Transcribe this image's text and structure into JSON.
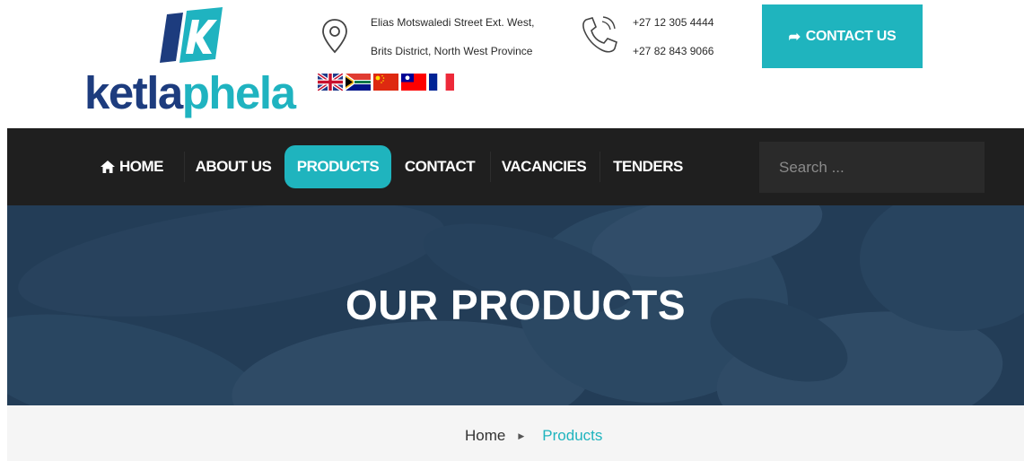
{
  "brand": {
    "name_part1": "ketla",
    "name_part2": "phela",
    "logo_letter": "K",
    "color_dark": "#1d3c7e",
    "color_accent": "#1fb3c0"
  },
  "header": {
    "address_icon": "map-pin-icon",
    "address_line1": "Elias Motswaledi Street Ext. West,",
    "address_line2": "Brits District, North West Province",
    "phone_icon": "phone-icon",
    "phone_line1": "+27 12 305 4444",
    "phone_line2": "+27 82 843 9066",
    "flags": [
      "uk-flag-icon",
      "south-africa-flag-icon",
      "china-flag-icon",
      "taiwan-flag-icon",
      "france-flag-icon"
    ],
    "contact_button": {
      "icon": "share-arrow-icon",
      "label": "CONTACT US"
    }
  },
  "nav": {
    "items": [
      {
        "label": "HOME",
        "icon": "home-icon"
      },
      {
        "label": "ABOUT US"
      },
      {
        "label": "PRODUCTS",
        "active": true
      },
      {
        "label": "CONTACT"
      },
      {
        "label": "VACANCIES"
      },
      {
        "label": "TENDERS"
      }
    ],
    "search_placeholder": "Search ..."
  },
  "hero": {
    "title": "OUR PRODUCTS"
  },
  "breadcrumb": {
    "home": "Home",
    "separator_icon": "caret-right-icon",
    "current": "Products"
  },
  "colors": {
    "accent": "#1fb4be",
    "nav_bg": "#1f1f1f",
    "hero_bg": "#28445e",
    "crumb_bg": "#f5f5f5"
  }
}
